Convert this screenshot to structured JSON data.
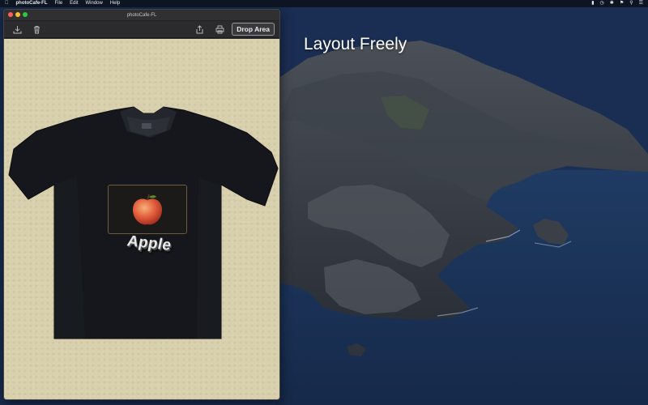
{
  "menubar": {
    "apple_icon": "apple-logo-icon",
    "app_name": "photoCafe-FL",
    "menus": [
      "File",
      "Edit",
      "Window",
      "Help"
    ],
    "status_icons": [
      "battery-icon",
      "clock-icon",
      "bluetooth-icon",
      "flag-icon",
      "search-icon",
      "wifi-icon"
    ]
  },
  "window": {
    "title": "photoCafe-FL",
    "toolbar": {
      "import_icon": "download-icon",
      "delete_icon": "trash-icon",
      "share_icon": "share-icon",
      "print_icon": "print-icon",
      "drop_area_label": "Drop Area"
    },
    "canvas": {
      "overlay_text": "Apple"
    }
  },
  "desktop": {
    "headline": "Layout Freely"
  }
}
